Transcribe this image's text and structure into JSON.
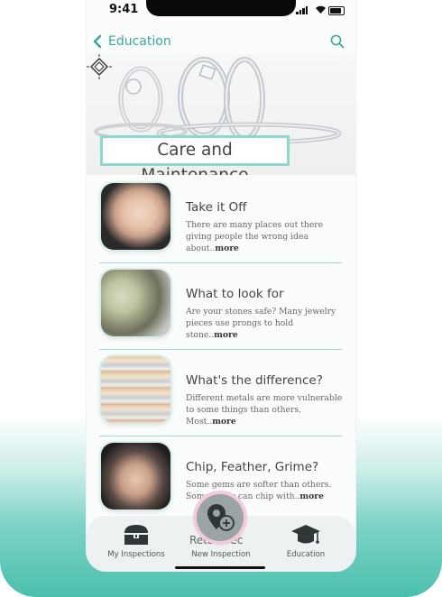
{
  "status": {
    "time": "9:41"
  },
  "header": {
    "back_label": "Education"
  },
  "hero": {
    "title": "Care and Maintenance"
  },
  "articles": [
    {
      "title": "Take it Off",
      "desc": "There are many places out there giving people the wrong idea about..",
      "more": "more"
    },
    {
      "title": "What to look for",
      "desc": "Are your stones safe? Many jewelry pieces use prongs to hold stone..",
      "more": "more"
    },
    {
      "title": "What's the difference?",
      "desc": "Different metals are more vulnerable to some things than others. Most..",
      "more": "more"
    },
    {
      "title": "Chip, Feather, Grime?",
      "desc": "Some gems are softer than others. Some...they can chip with..",
      "more": "more"
    }
  ],
  "partial_text": "Retail Sec",
  "tabs": {
    "inspections": "My Inspections",
    "new": "New Inspection",
    "education": "Education"
  },
  "colors": {
    "accent": "#3aa79a",
    "outline": "#8fd6cc",
    "fab_ring": "#f3c9de"
  }
}
